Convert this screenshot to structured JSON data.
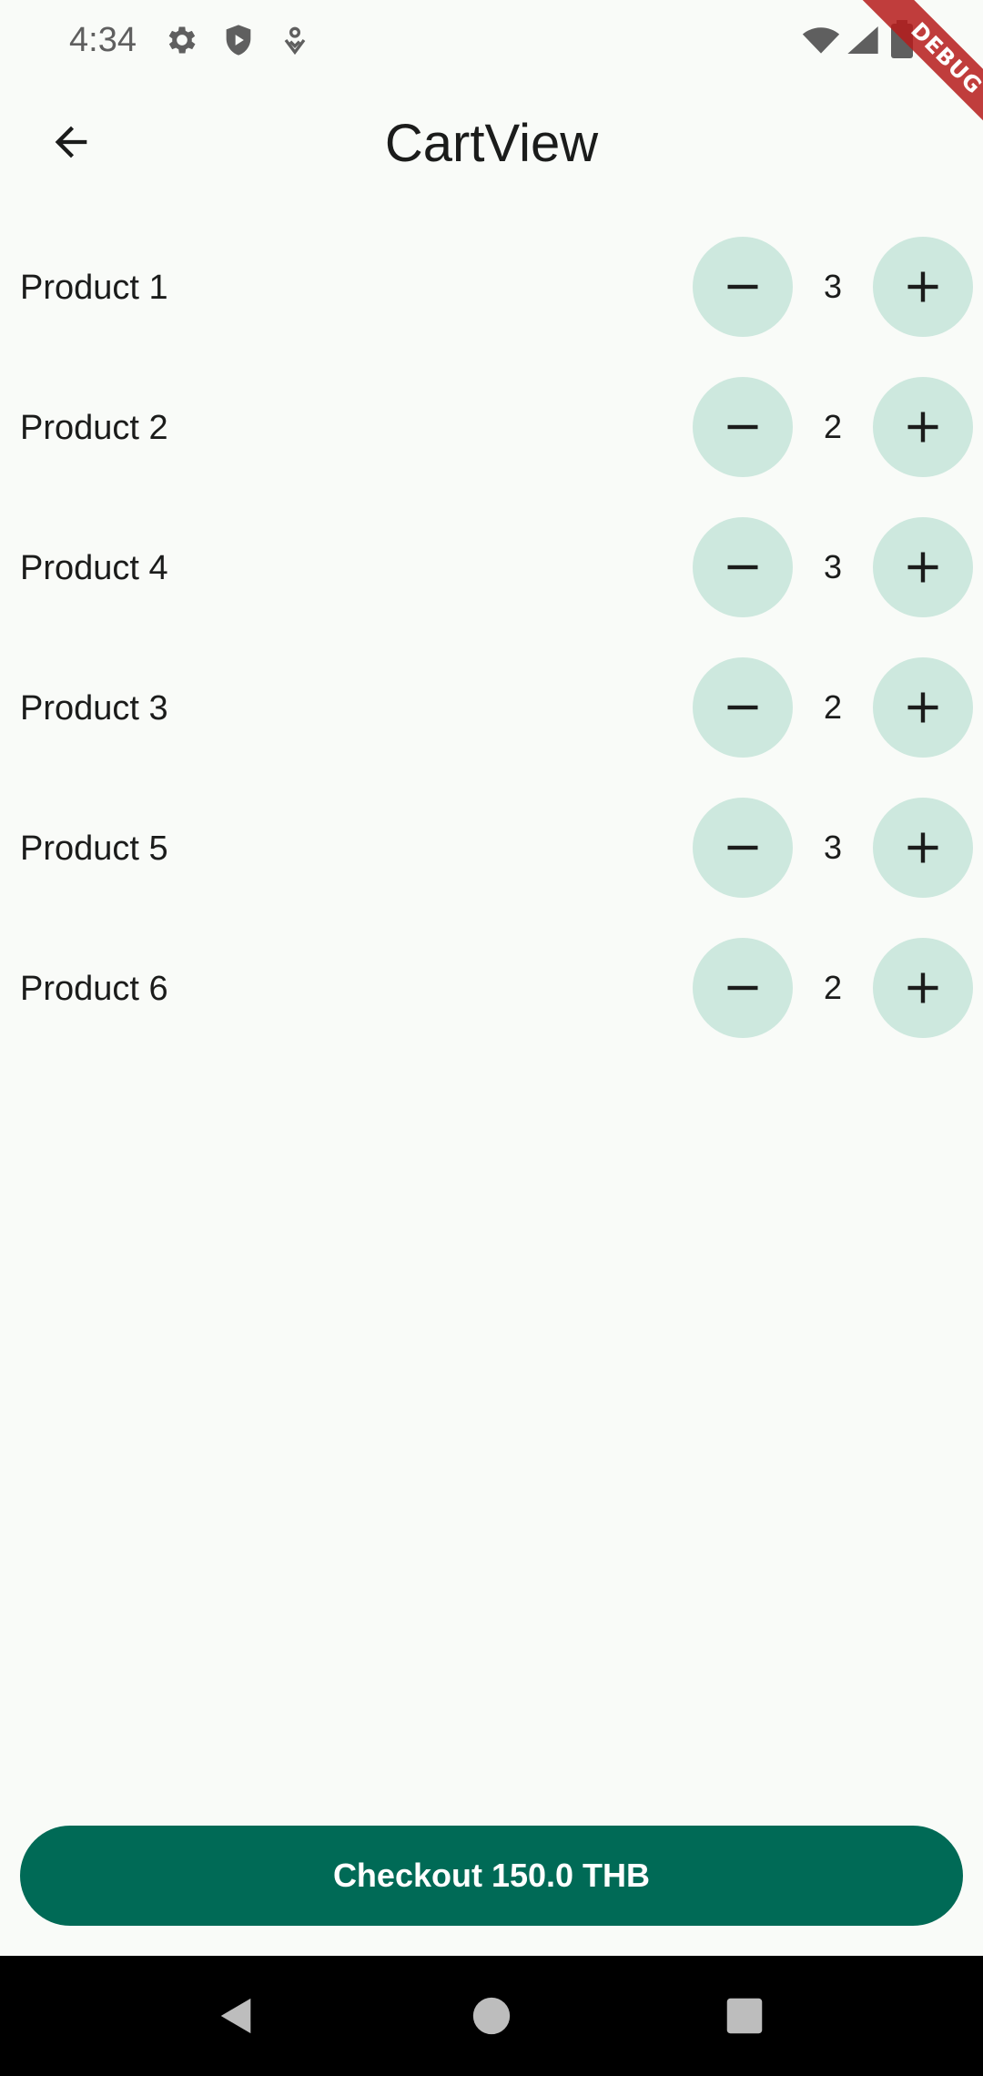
{
  "status_bar": {
    "time": "4:34",
    "icons_left": [
      "gear-icon",
      "shield-icon",
      "location-icon"
    ],
    "icons_right": [
      "wifi-icon",
      "cell-signal-icon",
      "battery-icon"
    ]
  },
  "debug_banner": {
    "label": "DEBUG",
    "color": "#b71c1c"
  },
  "app_bar": {
    "title": "CartView",
    "back_icon": "arrow-back-icon"
  },
  "cart": {
    "items": [
      {
        "name": "Product 1",
        "quantity": "3"
      },
      {
        "name": "Product 2",
        "quantity": "2"
      },
      {
        "name": "Product 4",
        "quantity": "3"
      },
      {
        "name": "Product 3",
        "quantity": "2"
      },
      {
        "name": "Product 5",
        "quantity": "3"
      },
      {
        "name": "Product 6",
        "quantity": "2"
      }
    ],
    "decrement_icon": "minus-icon",
    "increment_icon": "plus-icon"
  },
  "checkout": {
    "label": "Checkout 150.0 THB"
  },
  "colors": {
    "background": "#f9fbf8",
    "stepper_button": "#cde8de",
    "checkout_button": "#006a56",
    "nav_bar": "#000000"
  },
  "nav_bar": {
    "buttons": [
      "back-triangle-icon",
      "home-circle-icon",
      "recents-square-icon"
    ]
  }
}
